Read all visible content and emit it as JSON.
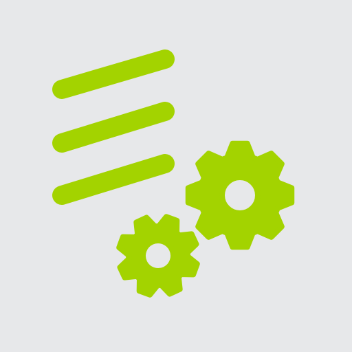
{
  "colors": {
    "background": "#e7e8ea",
    "accent": "#a3d300"
  },
  "icon": {
    "name": "settings-list-gears-icon",
    "elements": [
      "list-lines-icon",
      "small-gear-icon",
      "large-gear-icon"
    ]
  }
}
